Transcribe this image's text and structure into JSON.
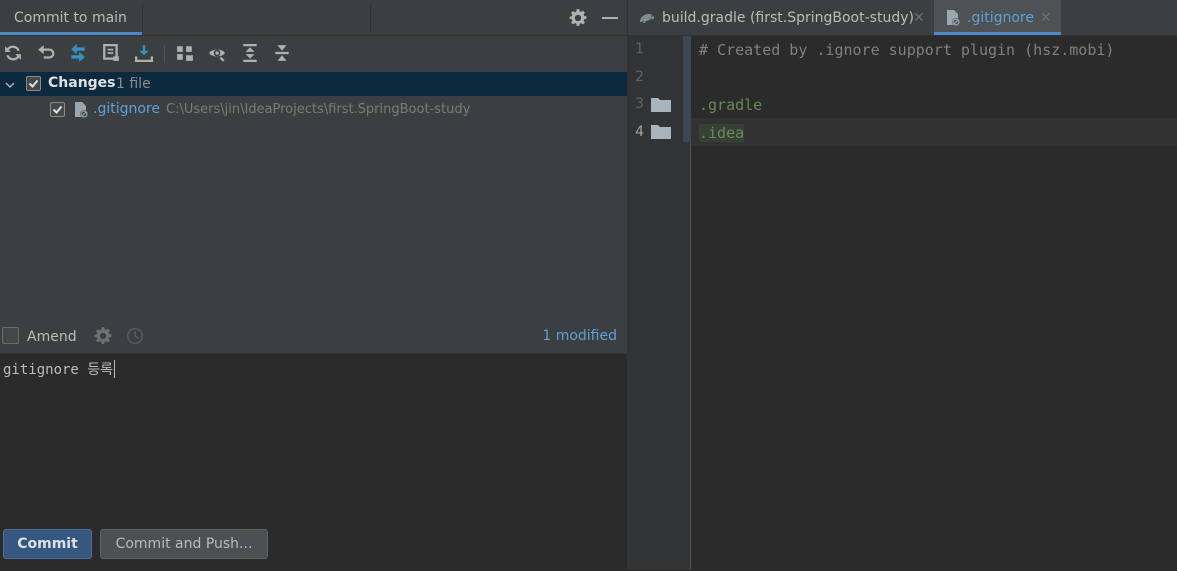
{
  "commit_panel": {
    "title": "Commit to main",
    "changes_label": "Changes",
    "changes_count": "1 file",
    "file": {
      "name": ".gitignore",
      "path": "C:\\Users\\jin\\IdeaProjects\\first.SpringBoot-study"
    },
    "amend_label": "Amend",
    "modified_link": "1 modified",
    "message": "gitignore 등록",
    "commit_button": "Commit",
    "commit_push_button": "Commit and Push..."
  },
  "editor": {
    "tabs": [
      {
        "label": "build.gradle (first.SpringBoot-study)",
        "icon": "gradle-icon",
        "active": false
      },
      {
        "label": ".gitignore",
        "icon": "gitignore-file-icon",
        "active": true
      }
    ],
    "lines": [
      {
        "num": "1",
        "text": "# Created by .ignore support plugin (hsz.mobi)"
      },
      {
        "num": "2",
        "text": ""
      },
      {
        "num": "3",
        "text": ".gradle"
      },
      {
        "num": "4",
        "text": ".idea"
      }
    ]
  },
  "colors": {
    "accent": "#4a88c7",
    "link": "#5e9fd6",
    "commit_button": "#365880",
    "selection_row": "#0d293e",
    "comment": "#808080",
    "directory_entry": "#6a8759"
  }
}
